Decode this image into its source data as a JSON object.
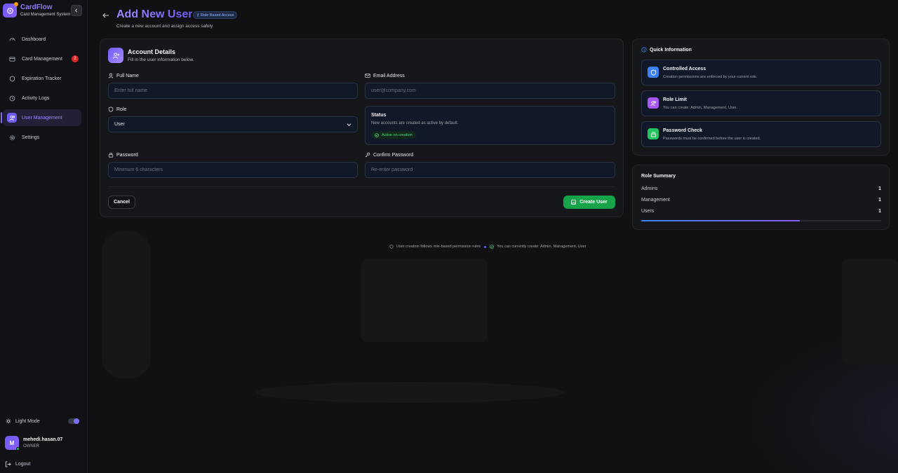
{
  "brand": {
    "name": "CardFlow",
    "subtitle": "Card Management System"
  },
  "sidebar": {
    "items": [
      {
        "label": "Dashboard",
        "icon": "gauge-icon"
      },
      {
        "label": "Card Management",
        "icon": "card-icon",
        "badge": "2"
      },
      {
        "label": "Expiration Tracker",
        "icon": "shield-icon"
      },
      {
        "label": "Activity Logs",
        "icon": "history-icon"
      },
      {
        "label": "User Management",
        "icon": "users-icon",
        "active": true
      },
      {
        "label": "Settings",
        "icon": "gear-icon"
      }
    ],
    "light_mode_label": "Light Mode",
    "user": {
      "initial": "M",
      "name": "mehedi.hasan.07",
      "role": "OWNER"
    },
    "logout_label": "Logout"
  },
  "header": {
    "title": "Add New User",
    "pill": "Role Based Access",
    "subtitle": "Create a new account and assign access safely."
  },
  "form": {
    "title": "Account Details",
    "subtitle": "Fill in the user information below.",
    "full_name_label": "Full Name",
    "full_name_placeholder": "Enter full name",
    "email_label": "Email Address",
    "email_placeholder": "user@company.com",
    "role_label": "Role",
    "role_value": "User",
    "status_title": "Status",
    "status_desc": "New accounts are created as active by default.",
    "status_pill": "Active on creation",
    "password_label": "Password",
    "password_placeholder": "Minimum 6 characters",
    "confirm_label": "Confirm Password",
    "confirm_placeholder": "Re-enter password",
    "cancel_label": "Cancel",
    "create_label": "Create User"
  },
  "quick_info": {
    "title": "Quick Information",
    "items": [
      {
        "title": "Controlled Access",
        "desc": "Creation permissions are enforced by your current role.",
        "icon": "shield-icon",
        "color": "#3b82f6"
      },
      {
        "title": "Role Limit",
        "desc": "You can create: Admin, Management, User.",
        "icon": "users-icon",
        "color": "#a855f7"
      },
      {
        "title": "Password Check",
        "desc": "Passwords must be confirmed before the user is created.",
        "icon": "lock-icon",
        "color": "#22c55e"
      }
    ]
  },
  "role_summary": {
    "title": "Role Summary",
    "rows": [
      {
        "label": "Admins",
        "value": "1"
      },
      {
        "label": "Management",
        "value": "1"
      },
      {
        "label": "Users",
        "value": "1"
      }
    ]
  },
  "footer": {
    "note1": "User creation follows role-based permission rules",
    "note2": "You can currently create: Admin, Management, User"
  },
  "colors": {
    "accent": "#6d5cf6",
    "success": "#16a34a",
    "danger": "#dc2626"
  }
}
